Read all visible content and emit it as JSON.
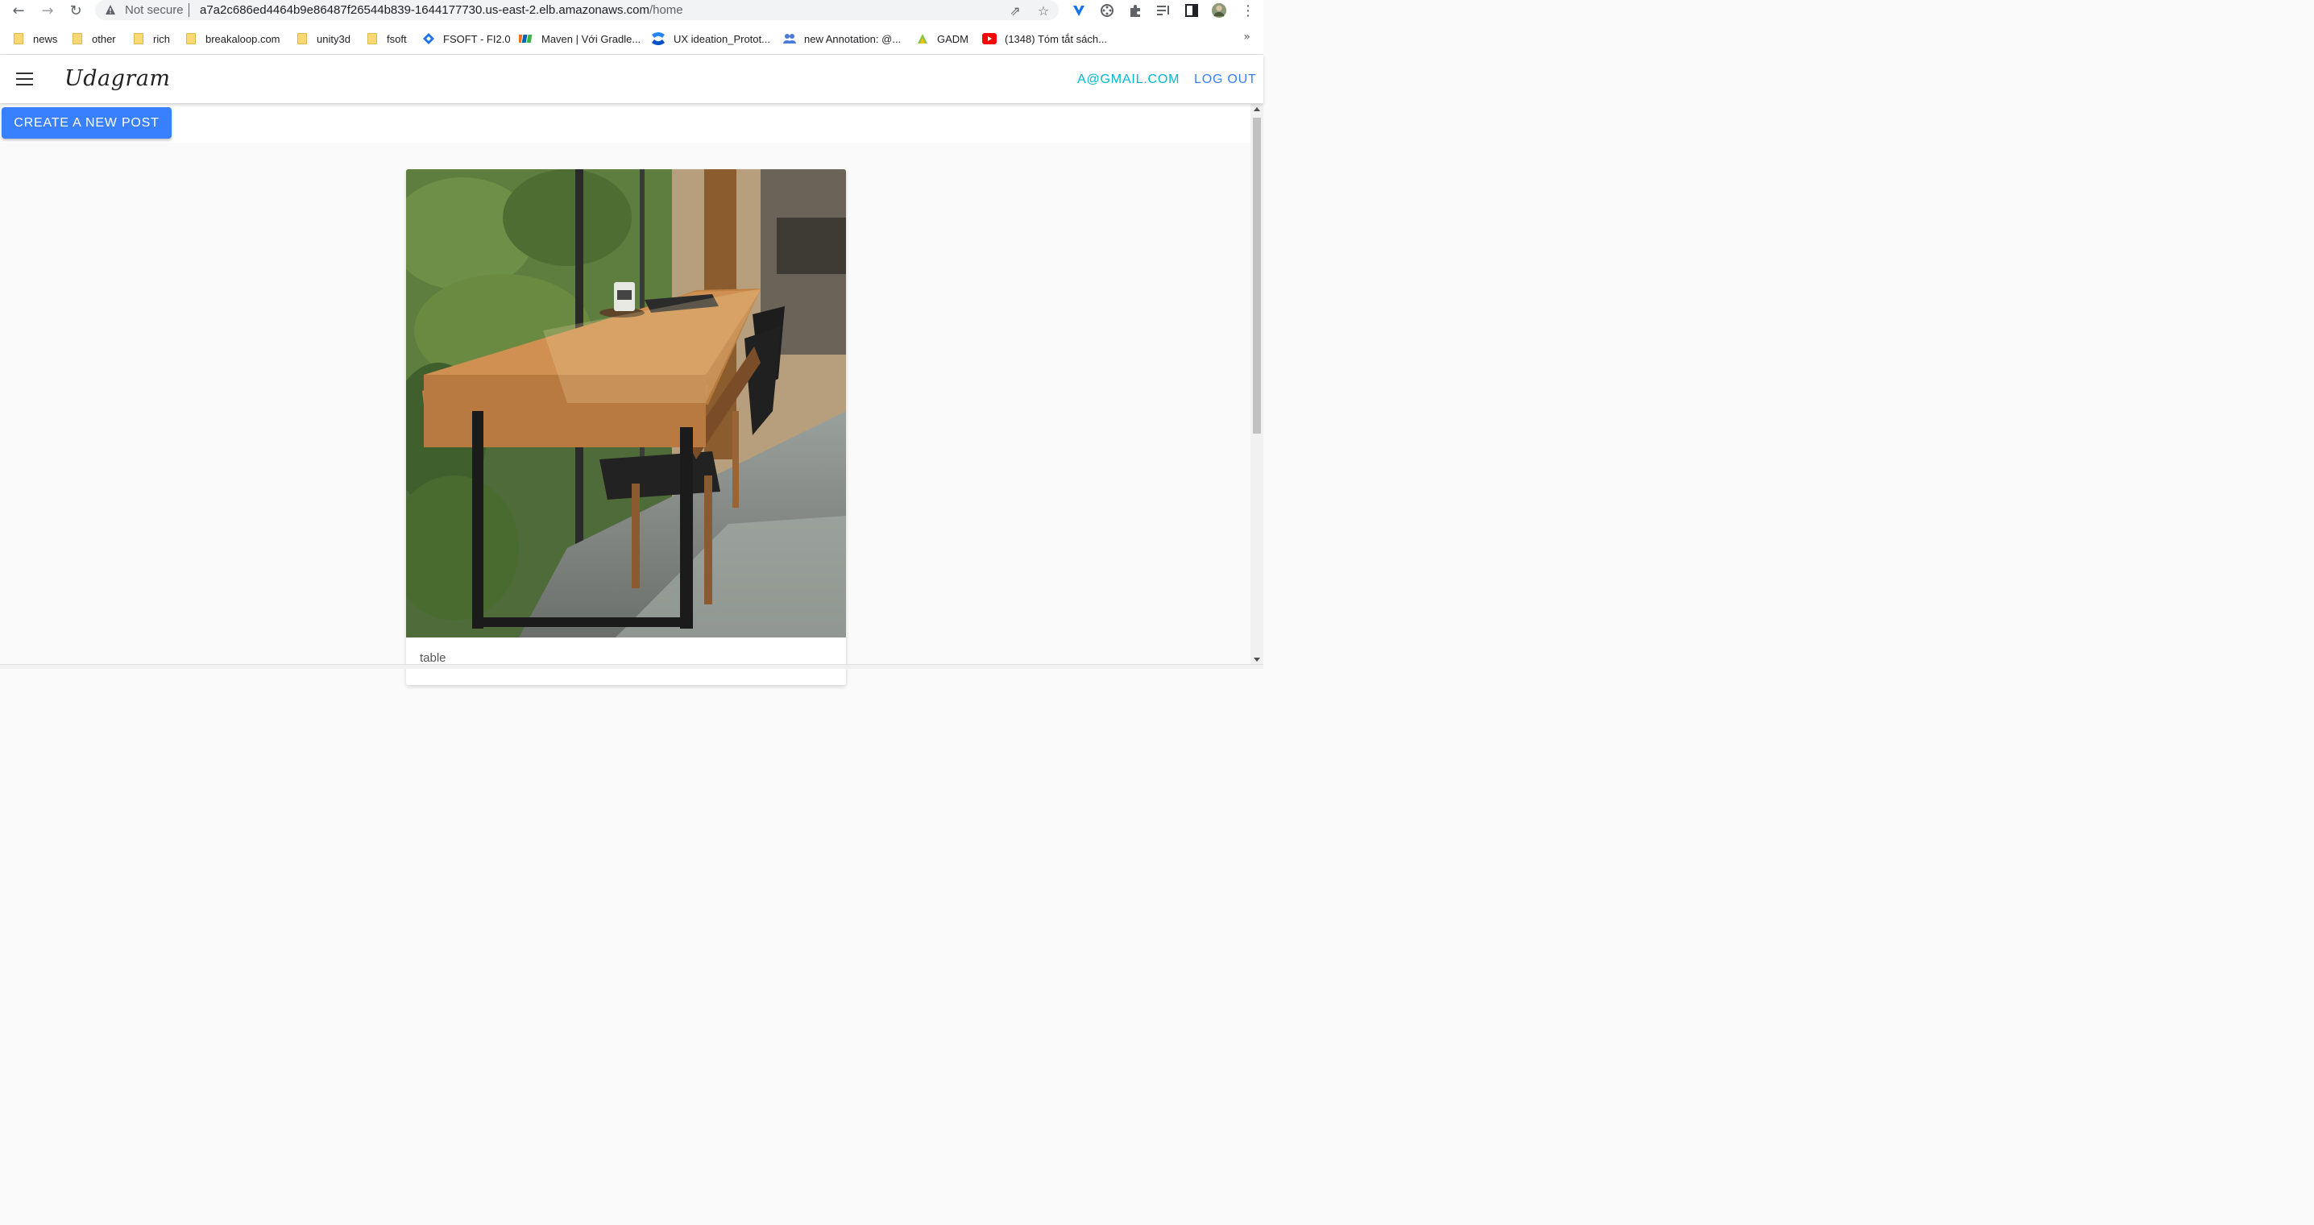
{
  "browser": {
    "security_label": "Not secure",
    "url_host": "a7a2c686ed4464b9e86487f26544b839-1644177730.us-east-2.elb.amazonaws.com",
    "url_path": "/home"
  },
  "bookmarks": [
    {
      "label": "news",
      "type": "folder"
    },
    {
      "label": "other",
      "type": "folder"
    },
    {
      "label": "rich",
      "type": "folder"
    },
    {
      "label": "breakaloop.com",
      "type": "folder"
    },
    {
      "label": "unity3d",
      "type": "folder"
    },
    {
      "label": "fsoft",
      "type": "folder"
    },
    {
      "label": "FSOFT - FI2.0",
      "type": "link",
      "icon": "diamond-icon"
    },
    {
      "label": "Maven | Với Gradle...",
      "type": "link",
      "icon": "fpt-icon"
    },
    {
      "label": "UX ideation_Protot...",
      "type": "link",
      "icon": "confluence-icon"
    },
    {
      "label": "new Annotation: @...",
      "type": "link",
      "icon": "people-icon"
    },
    {
      "label": "GADM",
      "type": "link",
      "icon": "gadm-icon"
    },
    {
      "label": "(1348) Tóm tắt sách...",
      "type": "link",
      "icon": "youtube-icon"
    }
  ],
  "bookmarks_more": "»",
  "app": {
    "brand": "Udagram",
    "user_email": "A@GMAIL.COM",
    "logout_label": "LOG OUT",
    "create_post_label": "CREATE A NEW POST"
  },
  "post": {
    "caption": "table"
  },
  "colors": {
    "accent_cyan": "#00b8d4",
    "accent_blue": "#3880ff",
    "background": "#fafafa"
  }
}
